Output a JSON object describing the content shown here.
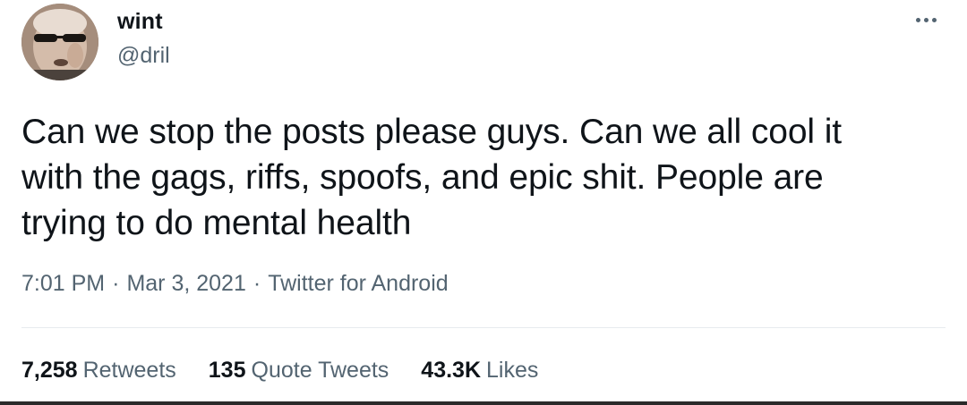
{
  "author": {
    "display_name": "wint",
    "handle": "@dril",
    "avatar_icon": "avatar-photo-sunglasses"
  },
  "more_icon": "more-horizontal-icon",
  "tweet": {
    "text_line_1": "Can we stop the posts please guys. Can we all cool it",
    "text_line_2": "with the gags, riffs, spoofs, and epic shit. People are",
    "text_line_3": "trying to do mental health"
  },
  "meta": {
    "time": "7:01 PM",
    "date": "Mar 3, 2021",
    "source": "Twitter for Android",
    "separator": "·"
  },
  "stats": {
    "retweets_count": "7,258",
    "retweets_label": "Retweets",
    "quotes_count": "135",
    "quotes_label": "Quote Tweets",
    "likes_count": "43.3K",
    "likes_label": "Likes"
  },
  "colors": {
    "text_primary": "#0f1419",
    "text_secondary": "#536471",
    "divider": "#e7ebee",
    "background": "#ffffff"
  }
}
